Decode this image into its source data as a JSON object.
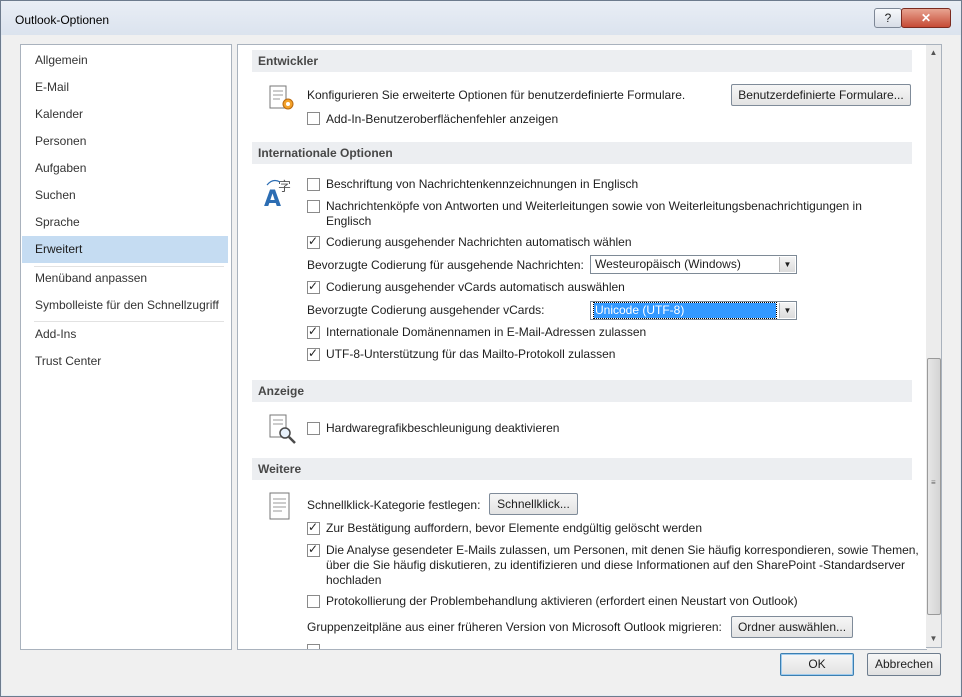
{
  "window": {
    "title": "Outlook-Optionen",
    "help_label": "?",
    "close_label": "✕"
  },
  "nav": {
    "items": [
      {
        "label": "Allgemein"
      },
      {
        "label": "E-Mail"
      },
      {
        "label": "Kalender"
      },
      {
        "label": "Personen"
      },
      {
        "label": "Aufgaben"
      },
      {
        "label": "Suchen"
      },
      {
        "label": "Sprache"
      },
      {
        "label": "Erweitert",
        "selected": true
      },
      {
        "label": "Menüband anpassen"
      },
      {
        "label": "Symbolleiste für den Schnellzugriff"
      },
      {
        "label": "Add-Ins"
      },
      {
        "label": "Trust Center"
      }
    ]
  },
  "sections": {
    "entwickler": {
      "heading": "Entwickler",
      "description": "Konfigurieren Sie erweiterte Optionen für benutzerdefinierte Formulare.",
      "forms_button": "Benutzerdefinierte Formulare...",
      "addin_errors": {
        "label": "Add-In-Benutzeroberflächenfehler anzeigen",
        "checked": false
      }
    },
    "international": {
      "heading": "Internationale Optionen",
      "flags_english": {
        "label": "Beschriftung von Nachrichtenkennzeichnungen in Englisch",
        "checked": false
      },
      "headers_english": {
        "label_line1": "Nachrichtenköpfe von Antworten und Weiterleitungen sowie von Weiterleitungsbenachrichtigungen in",
        "label_line2": "Englisch",
        "checked": false
      },
      "auto_encoding": {
        "label": "Codierung ausgehender Nachrichten automatisch wählen",
        "checked": true
      },
      "preferred_encoding_label": "Bevorzugte Codierung für ausgehende Nachrichten:",
      "preferred_encoding_value": "Westeuropäisch (Windows)",
      "auto_vcard": {
        "label": "Codierung ausgehender vCards automatisch auswählen",
        "checked": true
      },
      "vcard_encoding_label": "Bevorzugte Codierung ausgehender vCards:",
      "vcard_encoding_value": "Unicode (UTF-8)",
      "idn": {
        "label": "Internationale Domänennamen in E-Mail-Adressen zulassen",
        "checked": true
      },
      "utf8_mailto": {
        "label": "UTF-8-Unterstützung für das Mailto-Protokoll zulassen",
        "checked": true
      }
    },
    "anzeige": {
      "heading": "Anzeige",
      "hw_accel": {
        "label": "Hardwaregrafikbeschleunigung deaktivieren",
        "checked": false
      }
    },
    "weitere": {
      "heading": "Weitere",
      "quickclick_label": "Schnellklick-Kategorie festlegen:",
      "quickclick_button": "Schnellklick...",
      "confirm_delete": {
        "label": "Zur Bestätigung auffordern, bevor Elemente endgültig gelöscht werden",
        "checked": true
      },
      "analysis": {
        "line1": "Die Analyse gesendeter E-Mails zulassen, um Personen, mit denen Sie häufig korrespondieren, sowie Themen,",
        "line2": "über die Sie häufig diskutieren, zu identifizieren und diese Informationen auf den SharePoint -Standardserver",
        "line3": "hochladen",
        "checked": true
      },
      "logging": {
        "label": "Protokollierung der Problembehandlung aktivieren (erfordert einen Neustart von Outlook)",
        "checked": false
      },
      "migrate_label": "Gruppenzeitpläne aus einer früheren Version von Microsoft Outlook migrieren:",
      "migrate_button": "Ordner auswählen..."
    }
  },
  "footer": {
    "ok": "OK",
    "cancel": "Abbrechen"
  }
}
